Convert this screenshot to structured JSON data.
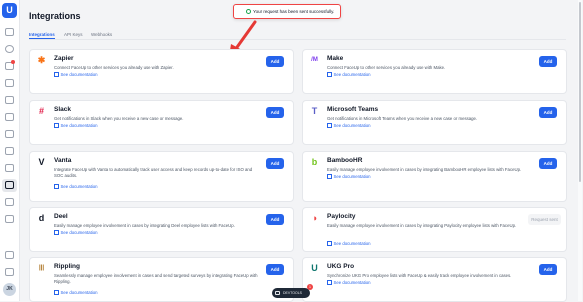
{
  "page": {
    "title": "Integrations"
  },
  "tabs": [
    {
      "label": "Integrations"
    },
    {
      "label": "API Keys"
    },
    {
      "label": "Webhooks"
    }
  ],
  "toast": {
    "message": "Your request has been sent successfully."
  },
  "link_label": "See documentation",
  "cards": [
    {
      "name": "Zapier",
      "desc": "Connect FaceUp to other services you already use with Zapier.",
      "action": "Add",
      "icon": "zapier-icon",
      "color": "#f97316"
    },
    {
      "name": "Make",
      "desc": "Connect FaceUp to other services you already use with Make.",
      "action": "Add",
      "icon": "make-icon",
      "color": "#7c3aed"
    },
    {
      "name": "Slack",
      "desc": "Get notifications in Slack when you receive a new case or message.",
      "action": "Add",
      "icon": "slack-icon",
      "color": "#e11d48"
    },
    {
      "name": "Microsoft Teams",
      "desc": "Get notifications in Microsoft Teams when you receive a new case or message.",
      "action": "Add",
      "icon": "teams-icon",
      "color": "#5b5fc7"
    },
    {
      "name": "Vanta",
      "desc": "Integrate FaceUp with Vanta to automatically track user access and keep records up-to-date for ISO and SOC audits.",
      "action": "Add",
      "icon": "vanta-icon",
      "color": "#111827"
    },
    {
      "name": "BambooHR",
      "desc": "Easily manage employee involvement in cases by integrating BambooHR employee lists with FaceUp.",
      "action": "Add",
      "icon": "bamboohr-icon",
      "color": "#73c41d"
    },
    {
      "name": "Deel",
      "desc": "Easily manage employee involvement in cases by integrating Deel employee lists with FaceUp.",
      "action": "Add",
      "icon": "deel-icon",
      "color": "#111827"
    },
    {
      "name": "Paylocity",
      "desc": "Easily manage employee involvement in cases by integrating Paylocity employee lists with FaceUp.",
      "action": "Request sent",
      "icon": "paylocity-icon",
      "color": "#ef4444"
    },
    {
      "name": "Rippling",
      "desc": "Seamlessly manage employee involvement in cases and send targeted surveys by integrating FaceUp with Rippling.",
      "action": "Add",
      "icon": "rippling-icon",
      "color": "#a16207"
    },
    {
      "name": "UKG Pro",
      "desc": "Synchronize UKG Pro employee lists with FaceUp & easily track employee involvement in cases.",
      "action": "Add",
      "icon": "ukg-icon",
      "color": "#0f766e"
    }
  ],
  "devtools": {
    "label": "DEVTOOLS",
    "badge": "1"
  },
  "user": {
    "initials": "JK"
  }
}
